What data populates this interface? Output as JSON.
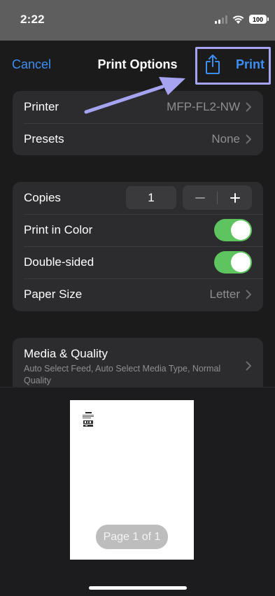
{
  "status_bar": {
    "time": "2:22",
    "battery": "100",
    "signal_icon": "cellular-signal-icon",
    "wifi_icon": "wifi-icon"
  },
  "nav": {
    "cancel": "Cancel",
    "title": "Print Options",
    "print": "Print",
    "share_icon": "share-icon"
  },
  "printer_group": {
    "printer_label": "Printer",
    "printer_value": "MFP-FL2-NW",
    "presets_label": "Presets",
    "presets_value": "None"
  },
  "options_group": {
    "copies_label": "Copies",
    "copies_value": "1",
    "minus": "−",
    "plus": "+",
    "color_label": "Print in Color",
    "color_on": true,
    "double_label": "Double-sided",
    "double_on": true,
    "paper_label": "Paper Size",
    "paper_value": "Letter"
  },
  "media_group": {
    "title": "Media & Quality",
    "subtitle": "Auto Select Feed, Auto Select Media Type, Normal Quality"
  },
  "preview": {
    "page_indicator": "Page 1 of 1"
  },
  "colors": {
    "accent": "#3d8ff6",
    "toggle_on": "#5ec45f",
    "annotation": "#a6a3f1"
  }
}
